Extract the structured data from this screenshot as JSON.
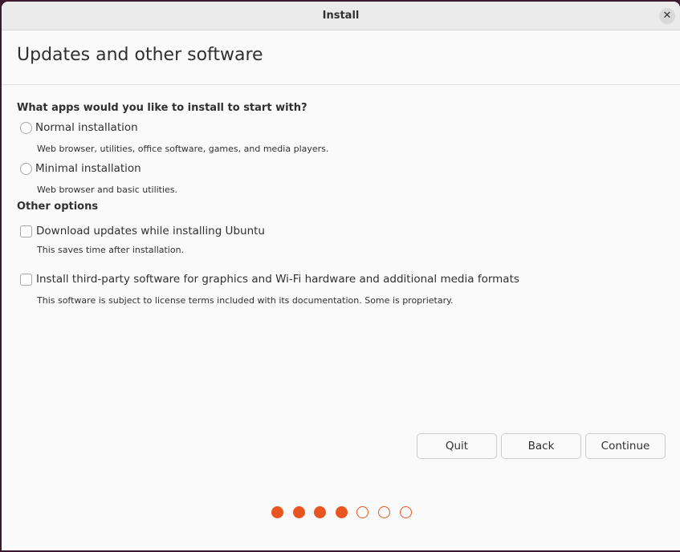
{
  "window": {
    "title": "Install",
    "close_icon": "close-icon"
  },
  "page": {
    "title": "Updates and other software"
  },
  "apps_section": {
    "heading": "What apps would you like to install to start with?",
    "options": [
      {
        "label": "Normal installation",
        "description": "Web browser, utilities, office software, games, and media players.",
        "selected": false
      },
      {
        "label": "Minimal installation",
        "description": "Web browser and basic utilities.",
        "selected": false
      }
    ]
  },
  "other_section": {
    "heading": "Other options",
    "options": [
      {
        "label": "Download updates while installing Ubuntu",
        "description": "This saves time after installation.",
        "checked": false
      },
      {
        "label": "Install third-party software for graphics and Wi-Fi hardware and additional media formats",
        "description": "This software is subject to license terms included with its documentation. Some is proprietary.",
        "checked": false
      }
    ]
  },
  "buttons": {
    "quit": "Quit",
    "back": "Back",
    "continue": "Continue"
  },
  "progress": {
    "total_steps": 7,
    "completed_steps": 4
  },
  "colors": {
    "accent": "#e95420",
    "text": "#303030",
    "background": "#fafafa"
  }
}
